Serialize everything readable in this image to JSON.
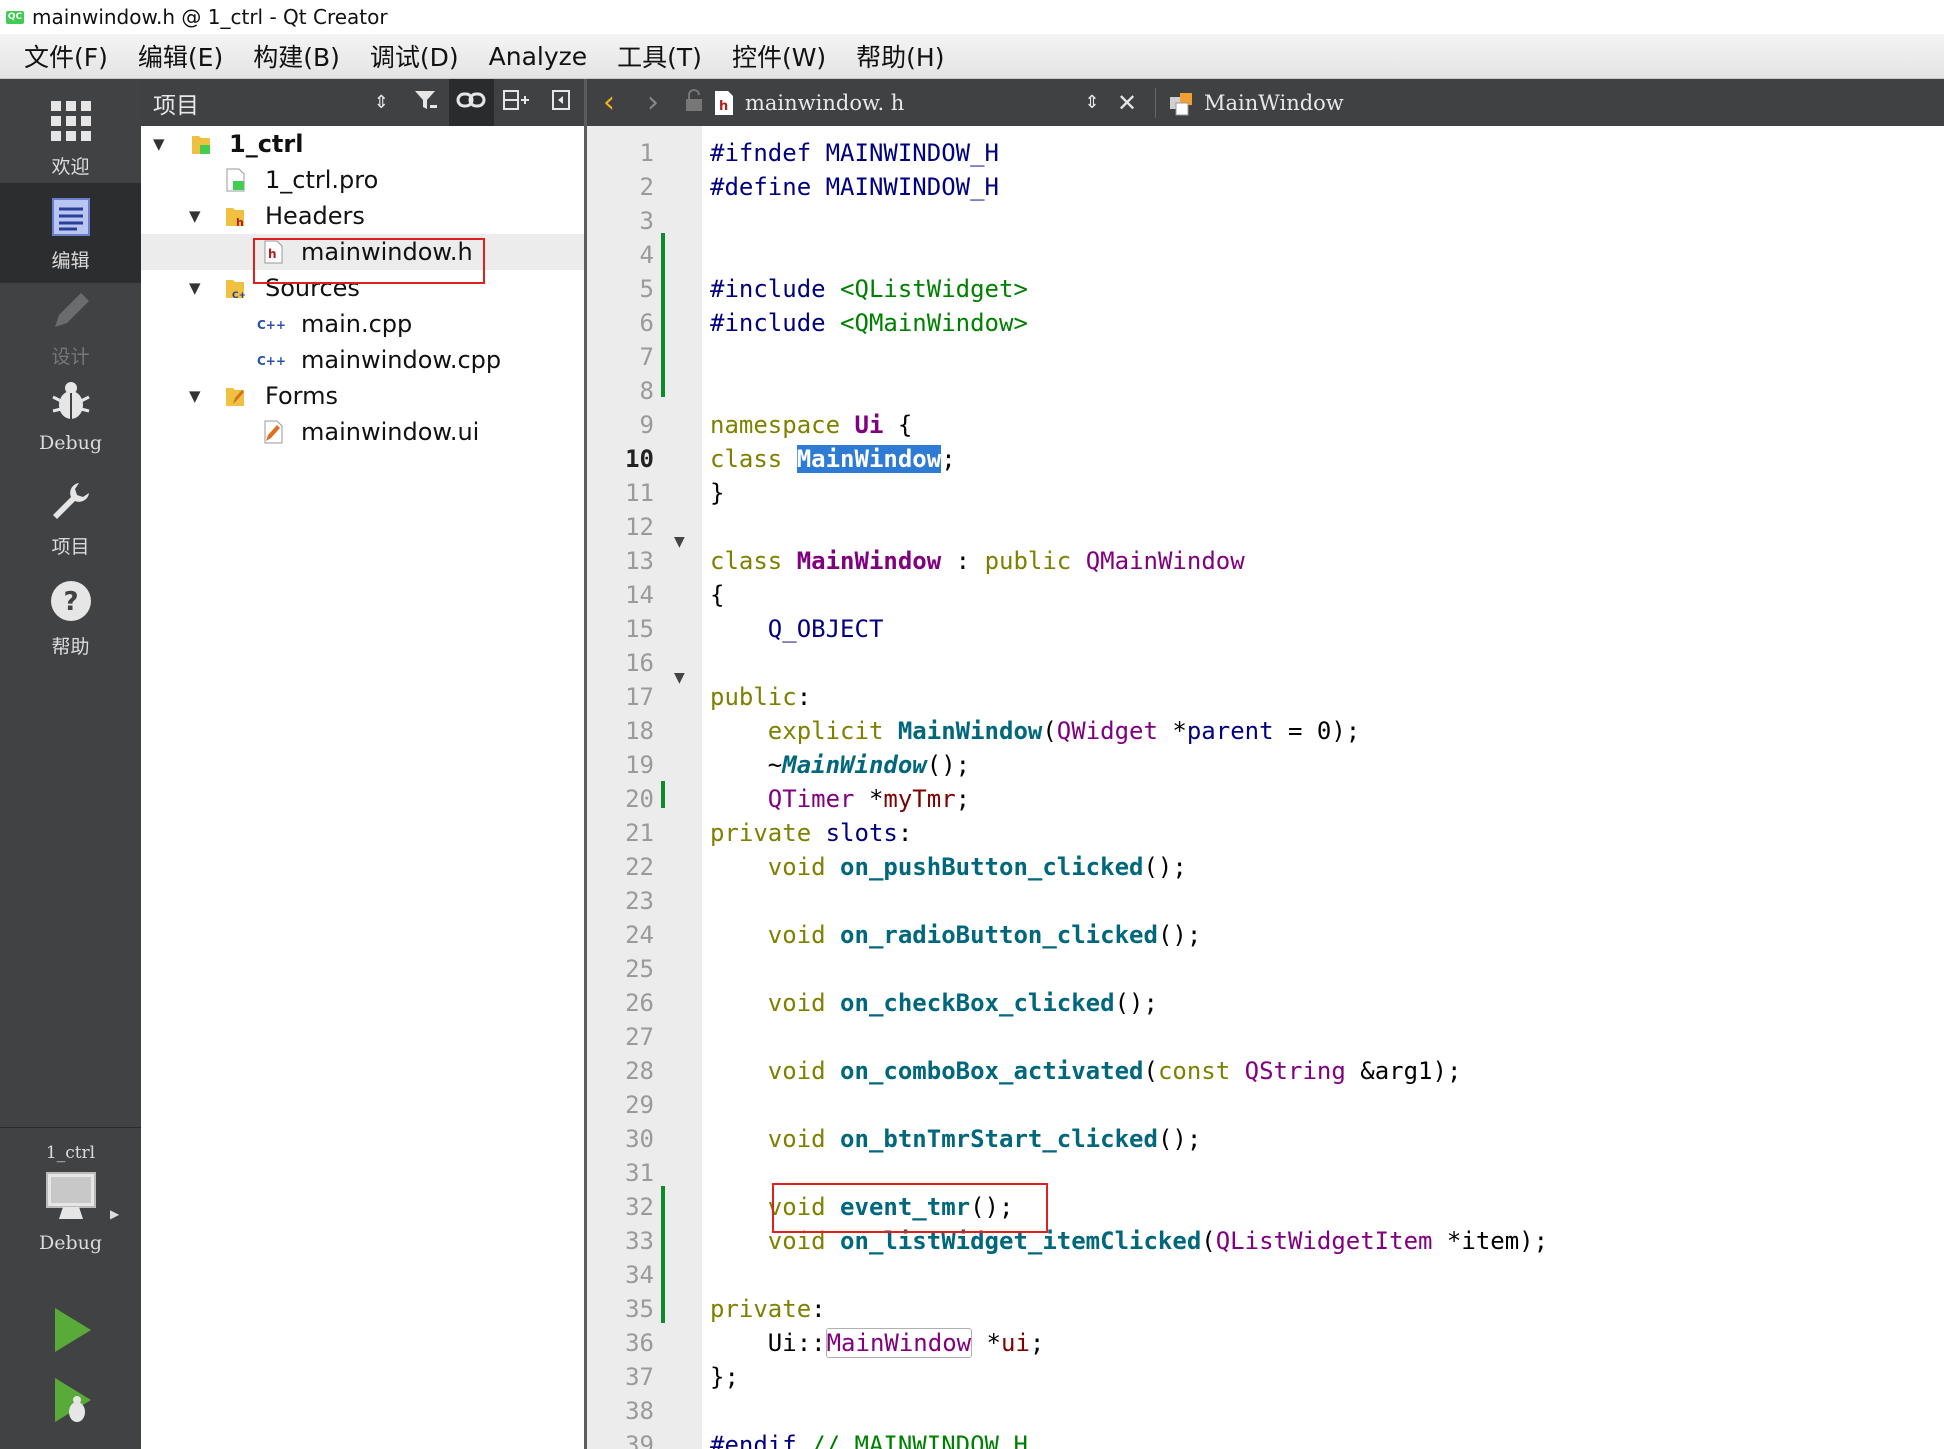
{
  "window": {
    "title": "mainwindow.h @ 1_ctrl - Qt Creator",
    "logo_text": "QC"
  },
  "menu": [
    "文件(F)",
    "编辑(E)",
    "构建(B)",
    "调试(D)",
    "Analyze",
    "工具(T)",
    "控件(W)",
    "帮助(H)"
  ],
  "modes": {
    "welcome": "欢迎",
    "edit": "编辑",
    "design": "设计",
    "debug": "Debug",
    "projects": "项目",
    "help": "帮助",
    "kit_project": "1_ctrl",
    "kit_build": "Debug"
  },
  "project_pane": {
    "label": "项目",
    "tree": [
      {
        "label": "1_ctrl"
      },
      {
        "label": "1_ctrl.pro"
      },
      {
        "label": "Headers"
      },
      {
        "label": "mainwindow.h"
      },
      {
        "label": "Sources"
      },
      {
        "label": "main.cpp"
      },
      {
        "label": "mainwindow.cpp"
      },
      {
        "label": "Forms"
      },
      {
        "label": "mainwindow.ui"
      }
    ]
  },
  "editor": {
    "file_name": "mainwindow. h",
    "symbol": "MainWindow",
    "current_line": 10,
    "line_numbers": [
      "1",
      "2",
      "3",
      "4",
      "5",
      "6",
      "7",
      "8",
      "9",
      "10",
      "11",
      "12",
      "13",
      "14",
      "15",
      "16",
      "17",
      "18",
      "19",
      "20",
      "21",
      "22",
      "23",
      "24",
      "25",
      "26",
      "27",
      "28",
      "29",
      "30",
      "31",
      "32",
      "33",
      "34",
      "35",
      "36",
      "37",
      "38",
      "39"
    ],
    "code": {
      "l1a": "#ifndef MAINWINDOW_H",
      "l2a": "#define MAINWINDOW_H",
      "l5a": "#include ",
      "l5b": "<QListWidget>",
      "l6a": "#include ",
      "l6b": "<QMainWindow>",
      "l9a": "namespace ",
      "l9b": "Ui",
      "l9c": " {",
      "l10a": "class ",
      "l10b": "MainWindow",
      "l10c": ";",
      "l11a": "}",
      "l13a": "class ",
      "l13b": "MainWindow",
      "l13c": " : ",
      "l13d": "public ",
      "l13e": "QMainWindow",
      "l14a": "{",
      "l15a": "    Q_OBJECT",
      "l17a": "public",
      "l17b": ":",
      "l18a": "    explicit ",
      "l18b": "MainWindow",
      "l18c": "(",
      "l18d": "QWidget",
      "l18e": " *",
      "l18f": "parent",
      "l18g": " = 0);",
      "l19a": "    ~",
      "l19b": "MainWindow",
      "l19c": "();",
      "l20a": "    ",
      "l20b": "QTimer",
      "l20c": " *",
      "l20d": "myTmr",
      "l20e": ";",
      "l21a": "private ",
      "l21b": "slots",
      "l21c": ":",
      "l22a": "    void ",
      "l22b": "on_pushButton_clicked",
      "l22c": "();",
      "l24a": "    void ",
      "l24b": "on_radioButton_clicked",
      "l24c": "();",
      "l26a": "    void ",
      "l26b": "on_checkBox_clicked",
      "l26c": "();",
      "l28a": "    void ",
      "l28b": "on_comboBox_activated",
      "l28c": "(",
      "l28d": "const ",
      "l28e": "QString",
      "l28f": " &arg1);",
      "l30a": "    void ",
      "l30b": "on_btnTmrStart_clicked",
      "l30c": "();",
      "l32a": "    void ",
      "l32b": "event_tmr",
      "l32c": "();",
      "l33a": "    void ",
      "l33b": "on_listWidget_itemClicked",
      "l33c": "(",
      "l33d": "QListWidgetItem",
      "l33e": " *item);",
      "l35a": "private",
      "l35b": ":",
      "l36a": "    Ui::",
      "l36b": "MainWindow",
      "l36c": " *",
      "l36d": "ui",
      "l36e": ";",
      "l37a": "};",
      "l39a": "#endif ",
      "l39b": "// MAINWINDOW_H"
    }
  },
  "colors": {
    "accent_selection": "#2e7bd6",
    "annotation_red": "#e02020",
    "change_bar": "#0d8a2a",
    "modebar": "#404244"
  }
}
